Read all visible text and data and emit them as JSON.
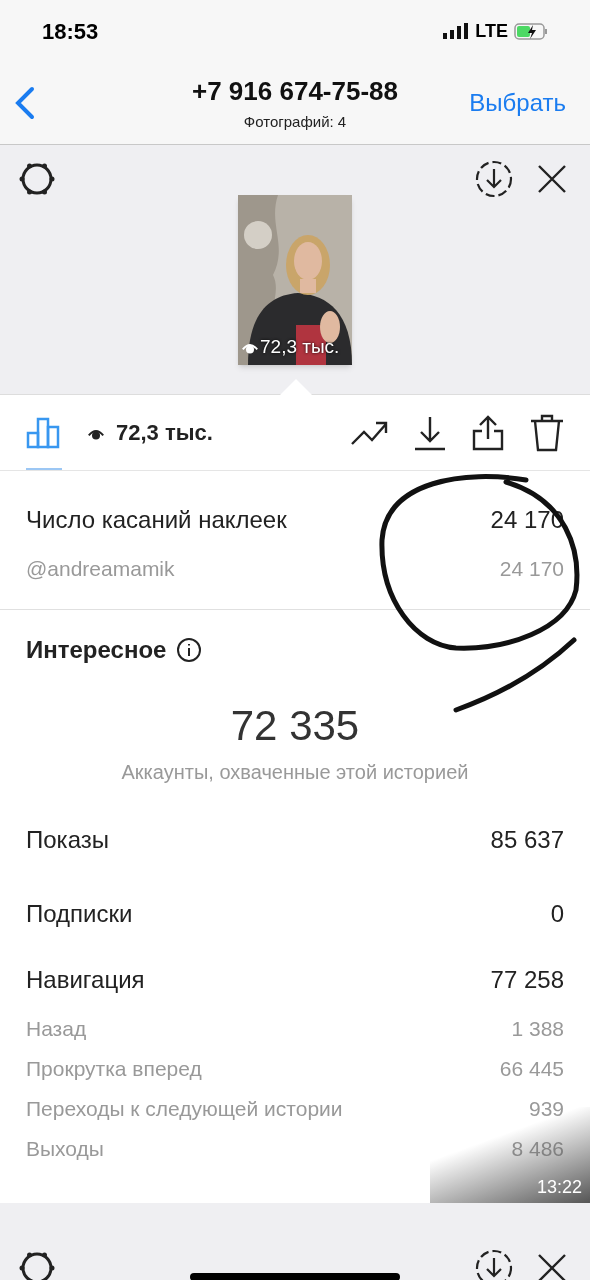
{
  "status_bar": {
    "time": "18:53",
    "network": "LTE"
  },
  "nav": {
    "title": "+7 916 674-75-88",
    "subtitle": "Фотографий: 4",
    "action": "Выбрать"
  },
  "story": {
    "kind": "picture",
    "views": "72,3 тыс."
  },
  "toolbar": {
    "views": "72,3 тыс."
  },
  "sticker_rows": [
    {
      "kind": "main",
      "label": "Число касаний наклеек",
      "value": "24 170"
    },
    {
      "kind": "sub",
      "label": "@andreamamik",
      "value": "24 170"
    }
  ],
  "interesting": {
    "title": "Интересное",
    "total": "72 335",
    "caption": "Аккаунты, охваченные этой историей",
    "metrics": [
      {
        "kind": "main",
        "label": "Показы",
        "value": "85 637"
      },
      {
        "kind": "main",
        "label": "Подписки",
        "value": "0"
      },
      {
        "kind": "group",
        "label": "Навигация",
        "value": "77 258"
      },
      {
        "kind": "sub",
        "label": "Назад",
        "value": "1 388"
      },
      {
        "kind": "sub",
        "label": "Прокрутка вперед",
        "value": "66 445"
      },
      {
        "kind": "sub",
        "label": "Переходы к следующей истории",
        "value": "939"
      },
      {
        "kind": "sub",
        "label": "Выходы",
        "value": "8 486"
      }
    ]
  },
  "video_duration": "13:22"
}
